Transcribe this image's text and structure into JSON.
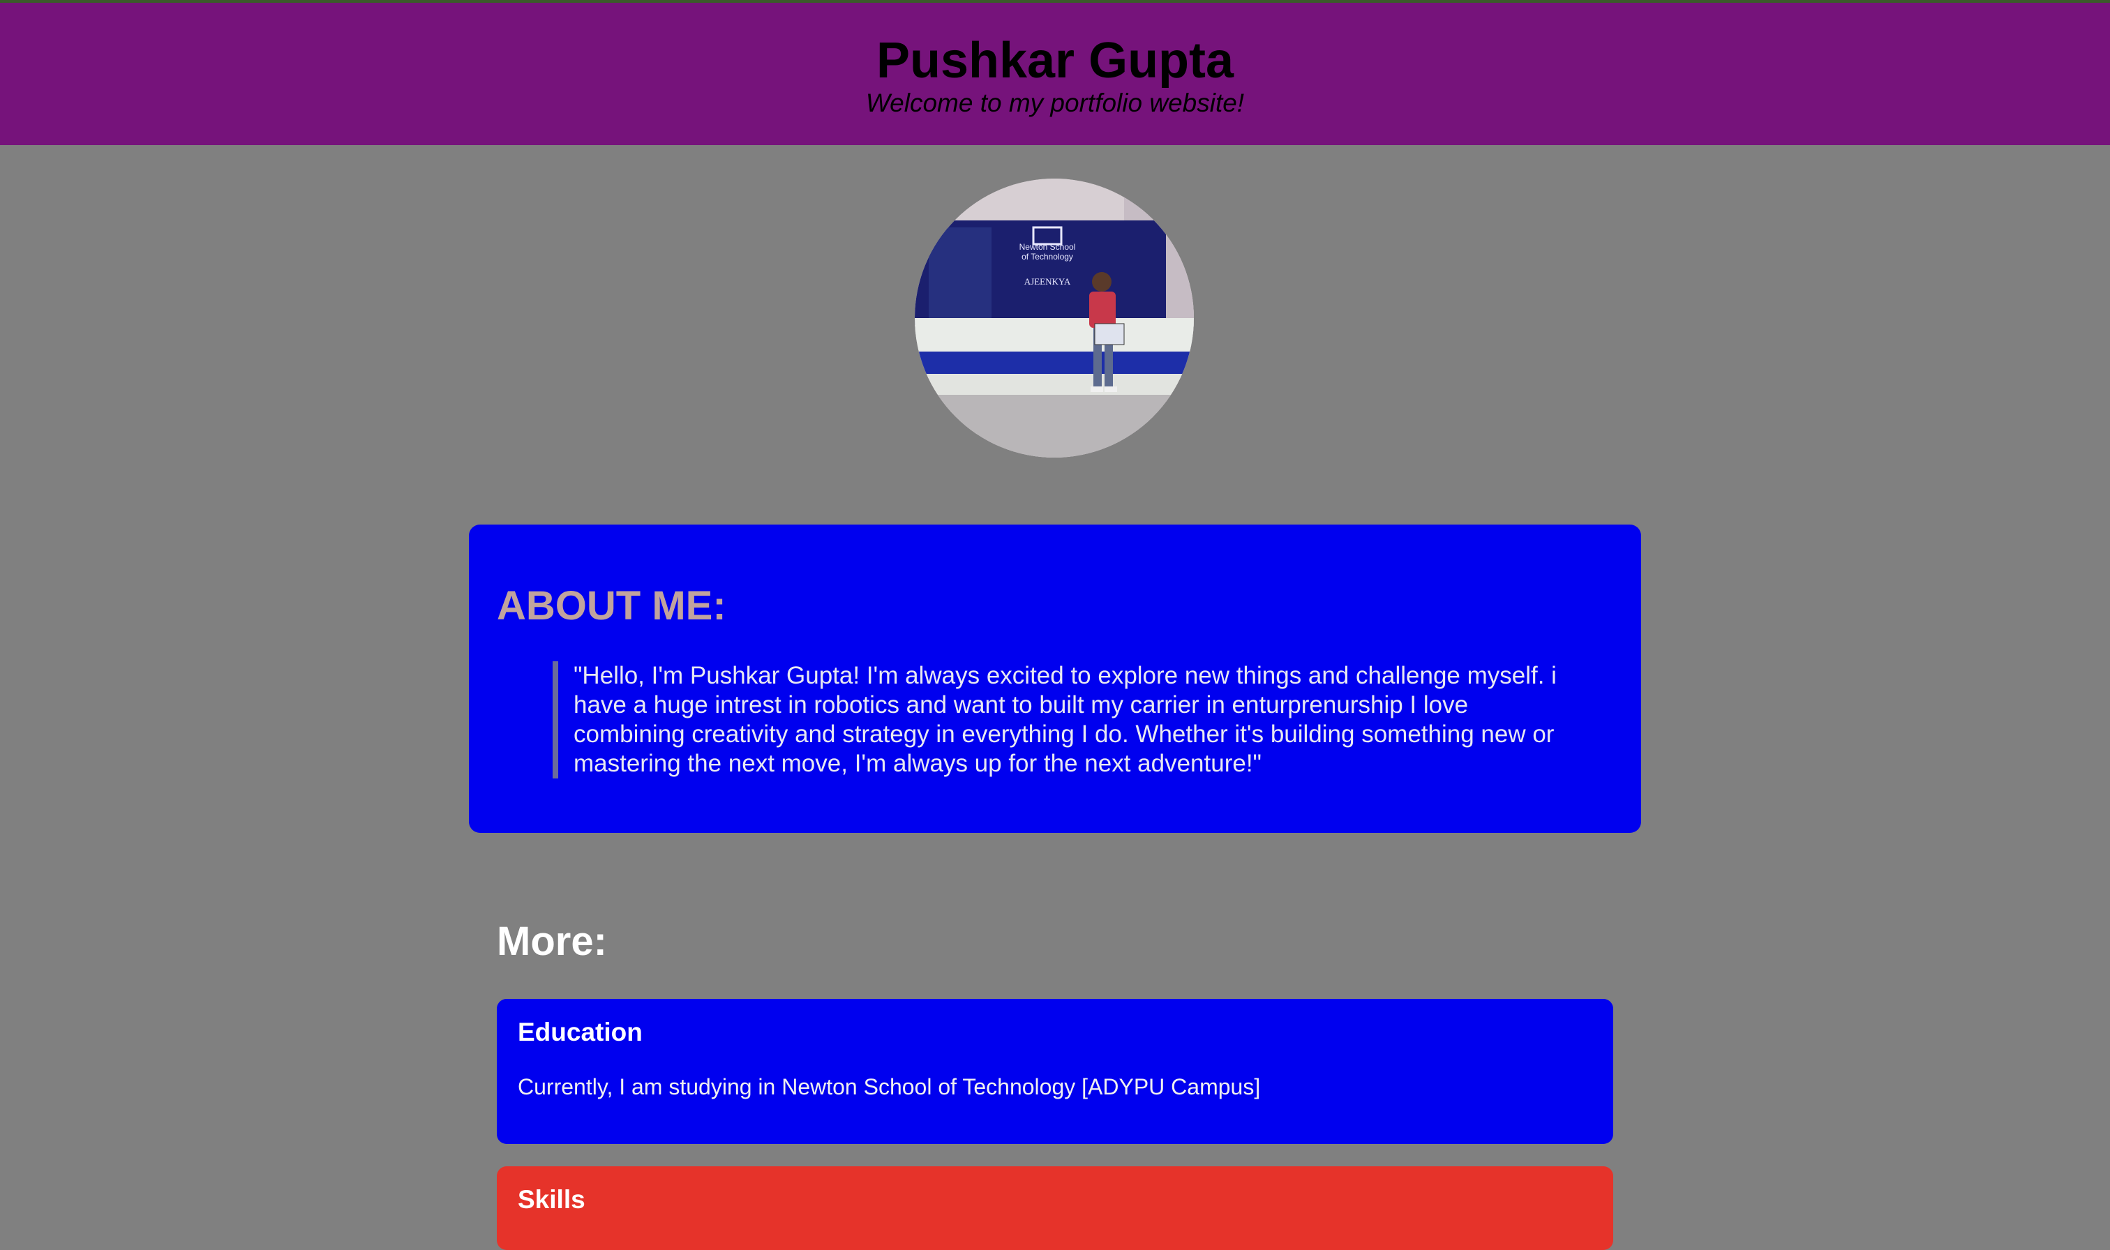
{
  "header": {
    "name": "Pushkar Gupta",
    "tagline": "Welcome to my portfolio website!"
  },
  "profile": {
    "photo_sign_lines": [
      "Newton School",
      "of Technology",
      "AJEENKYA"
    ]
  },
  "about": {
    "heading": "ABOUT ME:",
    "quote": "\"Hello, I'm Pushkar Gupta! I'm always excited to explore new things and challenge myself. i have a huge intrest in robotics and want to built my carrier in enturprenurship I love combining creativity and strategy in everything I do. Whether it's building something new or mastering the next move, I'm always up for the next adventure!\""
  },
  "more": {
    "heading": "More:",
    "cards": [
      {
        "title": "Education",
        "text": "Currently, I am studying in Newton School of Technology [ADYPU Campus]",
        "color": "#0000ef"
      },
      {
        "title": "Skills",
        "color": "#e6332a"
      }
    ]
  },
  "colors": {
    "page_bg": "#808080",
    "header_bg": "#76137b",
    "about_bg": "#0000ef",
    "about_heading": "#c1a39e"
  }
}
